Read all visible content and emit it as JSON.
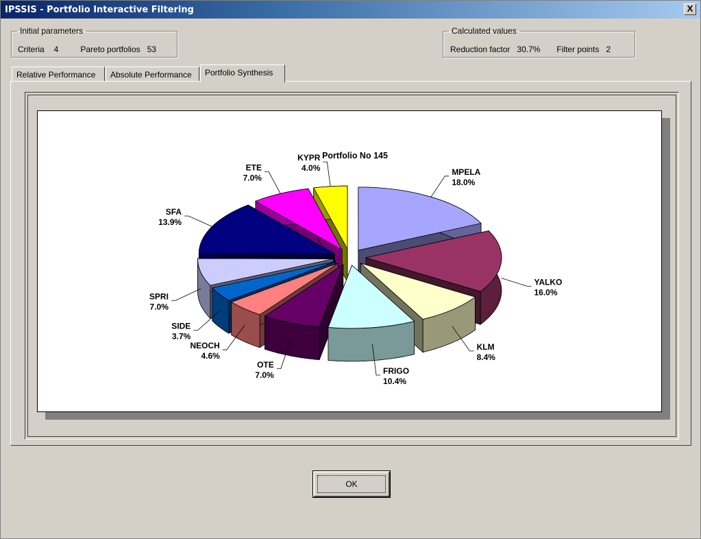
{
  "window": {
    "title": "IPSSIS - Portfolio Interactive Filtering",
    "close_label": "X"
  },
  "initial_parameters": {
    "legend": "Initial parameters",
    "criteria_label": "Criteria",
    "criteria_value": "4",
    "pareto_label": "Pareto portfolios",
    "pareto_value": "53"
  },
  "calculated_values": {
    "legend": "Calculated values",
    "reduction_label": "Reduction factor",
    "reduction_value": "30.7%",
    "filter_label": "Filter points",
    "filter_value": "2"
  },
  "tabs": [
    {
      "label": "Relative Performance",
      "active": false
    },
    {
      "label": "Absolute Performance",
      "active": false
    },
    {
      "label": "Portfolio Synthesis",
      "active": true
    }
  ],
  "ok_button": {
    "label": "OK"
  },
  "chart_data": {
    "type": "pie",
    "title": "Portfolio No 145",
    "exploded_3d": true,
    "slices": [
      {
        "label": "MPELA",
        "value": 18.0,
        "display": "18.0%",
        "color": "#a6a6ff"
      },
      {
        "label": "YALKO",
        "value": 16.0,
        "display": "16.0%",
        "color": "#993366"
      },
      {
        "label": "KLM",
        "value": 8.4,
        "display": "8.4%",
        "color": "#ffffcc"
      },
      {
        "label": "FRIGO",
        "value": 10.4,
        "display": "10.4%",
        "color": "#ccffff"
      },
      {
        "label": "OTE",
        "value": 7.0,
        "display": "7.0%",
        "color": "#660066"
      },
      {
        "label": "NEOCH",
        "value": 4.6,
        "display": "4.6%",
        "color": "#ff8080"
      },
      {
        "label": "SIDE",
        "value": 3.7,
        "display": "3.7%",
        "color": "#0066cc"
      },
      {
        "label": "SPRI",
        "value": 7.0,
        "display": "7.0%",
        "color": "#ccccff"
      },
      {
        "label": "SFA",
        "value": 13.9,
        "display": "13.9%",
        "color": "#000080"
      },
      {
        "label": "ETE",
        "value": 7.0,
        "display": "7.0%",
        "color": "#ff00ff"
      },
      {
        "label": "KYPR",
        "value": 4.0,
        "display": "4.0%",
        "color": "#ffff00"
      }
    ]
  }
}
